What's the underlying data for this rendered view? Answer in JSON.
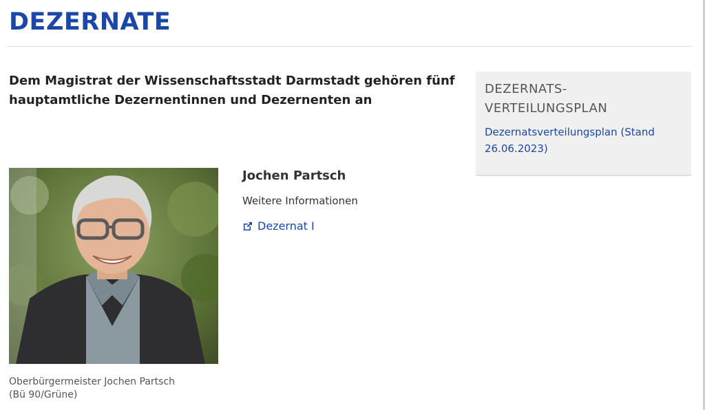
{
  "page": {
    "title": "DEZERNATE",
    "intro": "Dem Magistrat der Wissenschaftsstadt Darmstadt gehören fünf hauptamtliche Dezernentinnen und Dezernenten an"
  },
  "sidebar": {
    "title_line1": "DEZERNATS-",
    "title_line2": "VERTEILUNGSPLAN",
    "link_label": "Dezernatsverteilungsplan (Stand 26.06.2023)"
  },
  "person": {
    "name": "Jochen Partsch",
    "more_info": "Weitere Informationen",
    "link_label": "Dezernat I",
    "link_icon": "external-link-icon",
    "caption_line1": "Oberbürgermeister Jochen Partsch",
    "caption_line2": "(Bü 90/Grüne)"
  },
  "colors": {
    "accent": "#1a47a8",
    "aside_bg": "#f0f0f0"
  }
}
